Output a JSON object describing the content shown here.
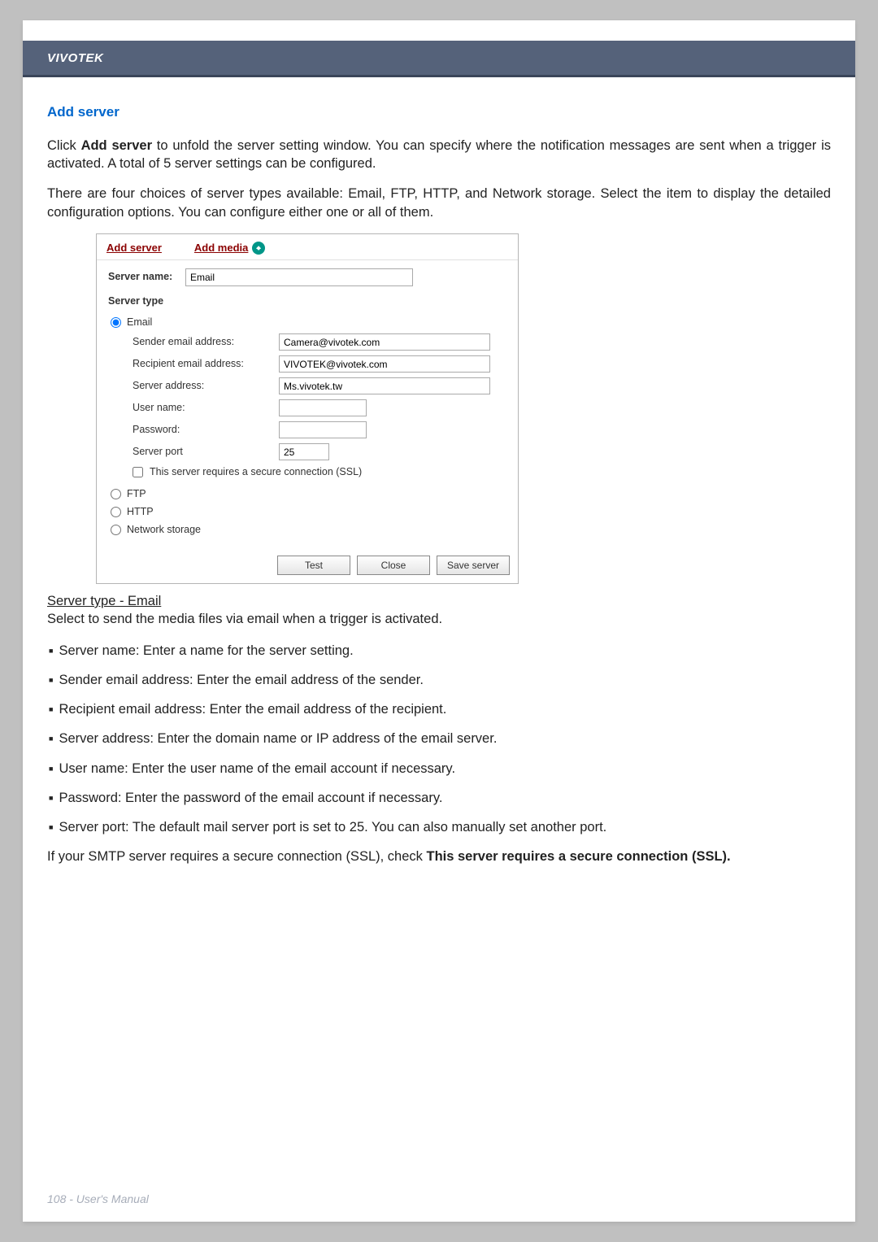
{
  "brand": "VIVOTEK",
  "section_title": "Add server",
  "intro_before": "Click ",
  "intro_bold": "Add server",
  "intro_after": " to unfold the server setting window. You can specify where the notification messages are sent when a trigger is activated. A total of 5 server settings can be configured.",
  "para2": "There are four choices of server types available: Email, FTP, HTTP, and Network storage. Select the item to display the detailed configuration options. You can configure either one or all of them.",
  "panel": {
    "tabs": {
      "add_server": "Add server",
      "add_media": "Add media"
    },
    "server_name_label": "Server name:",
    "server_name_value": "Email",
    "server_type_title": "Server type",
    "radios": {
      "email": "Email",
      "ftp": "FTP",
      "http": "HTTP",
      "network_storage": "Network storage"
    },
    "fields": {
      "sender_label": "Sender email address:",
      "sender_value": "Camera@vivotek.com",
      "recipient_label": "Recipient email address:",
      "recipient_value": "VIVOTEK@vivotek.com",
      "server_addr_label": "Server address:",
      "server_addr_value": "Ms.vivotek.tw",
      "username_label": "User name:",
      "username_value": "",
      "password_label": "Password:",
      "password_value": "",
      "port_label": "Server port",
      "port_value": "25",
      "ssl_checkbox": "This server requires a secure connection (SSL)"
    },
    "buttons": {
      "test": "Test",
      "close": "Close",
      "save": "Save server"
    }
  },
  "subhead": "Server type - Email",
  "sub_desc": "Select to send the media files via email when a trigger is activated.",
  "bullets": [
    "Server name: Enter a name for the server setting.",
    "Sender email address: Enter the email address of the sender.",
    "Recipient email address: Enter the email address of the recipient.",
    "Server address: Enter the domain name or IP address of the email server.",
    "User name: Enter the user name of the email account if necessary.",
    "Password: Enter the password of the email account if necessary.",
    "Server port: The default mail server port is set to 25. You can also manually set another port."
  ],
  "ssl_note_before": "If your SMTP server requires a secure connection (SSL), check ",
  "ssl_note_bold": "This server requires a secure connection (SSL).",
  "footer": "108 - User's Manual"
}
